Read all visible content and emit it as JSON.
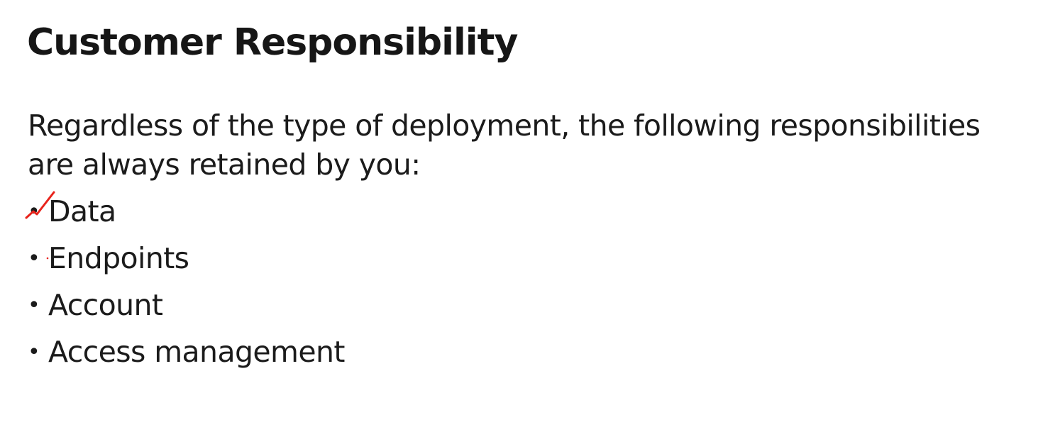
{
  "slide": {
    "title": "Customer Responsibility",
    "intro": "Regardless of the type of deployment, the following responsibilities are always retained by you:",
    "bullets": [
      {
        "label": "Data",
        "marked": true
      },
      {
        "label": "Endpoints",
        "marked": false
      },
      {
        "label": "Account",
        "marked": false
      },
      {
        "label": "Access management",
        "marked": false
      }
    ],
    "bullet_symbol": "•",
    "annotation": {
      "type": "handwritten-checkmark",
      "color": "#e8231b"
    }
  }
}
